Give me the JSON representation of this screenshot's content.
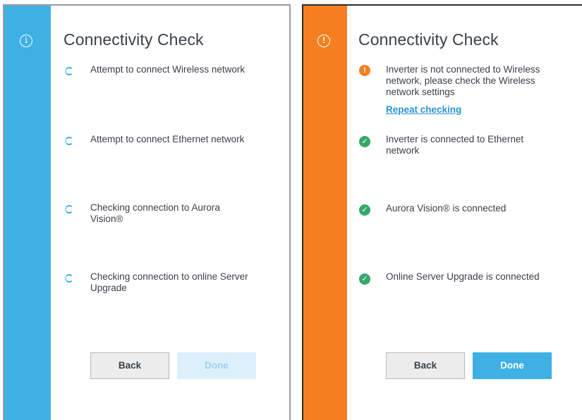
{
  "left_panel": {
    "title": "Connectivity Check",
    "header_icon": "info-icon",
    "accent_color": "#3fb0e4",
    "items": [
      {
        "text": "Attempt to connect Wireless network",
        "status": "checking"
      },
      {
        "text": "Attempt to connect Ethernet network",
        "status": "checking"
      },
      {
        "text": "Checking connection to Aurora Vision®",
        "status": "checking"
      },
      {
        "text": "Checking connection to online Server Upgrade",
        "status": "checking"
      }
    ],
    "back_label": "Back",
    "done_label": "Done",
    "done_enabled": false
  },
  "right_panel": {
    "title": "Connectivity Check",
    "header_icon": "warning-icon",
    "accent_color": "#f57f20",
    "items": [
      {
        "text": "Inverter is not connected to Wireless network, please check the Wireless network settings",
        "status": "error",
        "link": "Repeat checking"
      },
      {
        "text": "Inverter is connected to Ethernet network",
        "status": "ok"
      },
      {
        "text": "Aurora Vision® is connected",
        "status": "ok"
      },
      {
        "text": "Online Server Upgrade is connected",
        "status": "ok"
      }
    ],
    "back_label": "Back",
    "done_label": "Done",
    "done_enabled": true
  }
}
